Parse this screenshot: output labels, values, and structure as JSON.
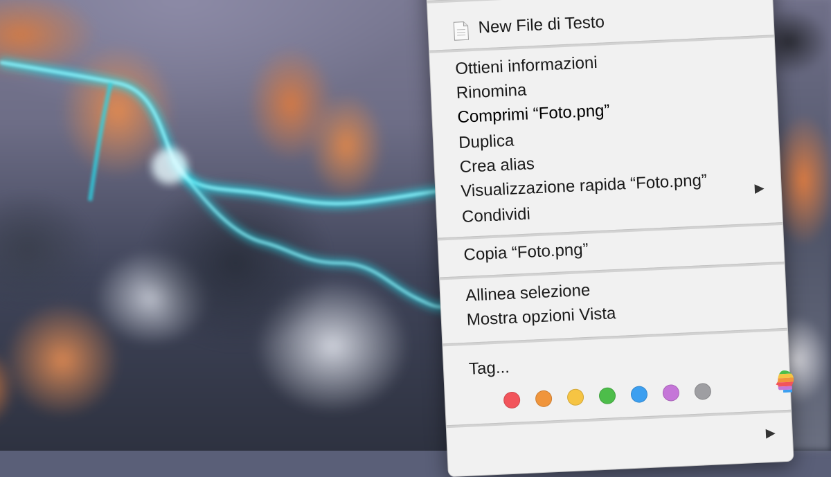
{
  "menu": {
    "new_file": "New File di Testo",
    "items_group1": [
      "Ottieni informazioni",
      "Rinomina",
      "Comprimi “Foto.png”",
      "Duplica",
      "Crea alias",
      "Visualizzazione rapida “Foto.png”",
      "Condividi"
    ],
    "copy": "Copia “Foto.png”",
    "items_group3": [
      "Allinea selezione",
      "Mostra opzioni Vista"
    ],
    "tags_label": "Tag...",
    "tag_colors": [
      "#f2545b",
      "#f0953c",
      "#f6c443",
      "#4dbd4a",
      "#3c9ff0",
      "#c576d8",
      "#9e9ea2"
    ],
    "icons": {
      "new_file": "text-document-icon",
      "share_submenu": "triangle-right-icon",
      "tags_edit": "colorful-head-icon",
      "bottom_submenu": "triangle-right-icon"
    }
  }
}
